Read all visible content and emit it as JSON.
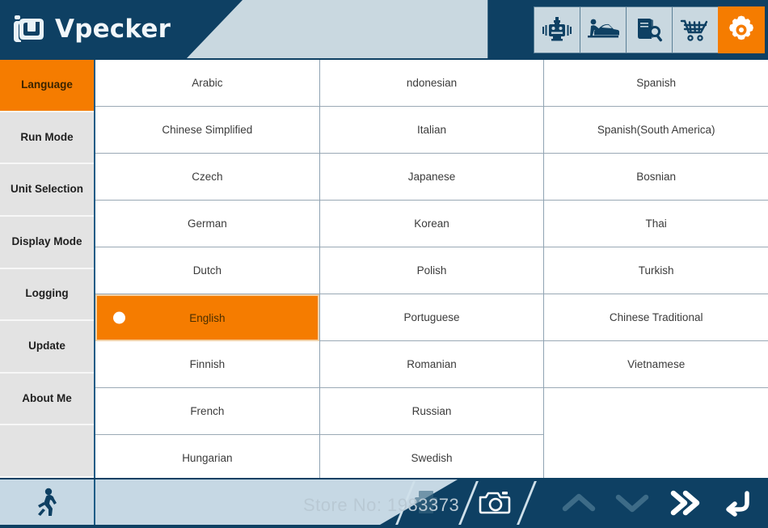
{
  "app": {
    "brand": "Vpecker",
    "logo_icon": "id-logo-icon",
    "accent_color": "#f57c00",
    "navy_color": "#0e4063",
    "panel_color": "#c9d8e0"
  },
  "header": {
    "icons": [
      {
        "name": "diagnostic-tool-icon",
        "label": "Diagnostic",
        "active": false
      },
      {
        "name": "car-repair-icon",
        "label": "Repair",
        "active": false
      },
      {
        "name": "manual-search-icon",
        "label": "Manual",
        "active": false
      },
      {
        "name": "shopping-cart-icon",
        "label": "Shop",
        "active": false
      },
      {
        "name": "settings-gear-icon",
        "label": "Settings",
        "active": true
      }
    ]
  },
  "sidebar": {
    "items": [
      {
        "label": "Language",
        "active": true
      },
      {
        "label": "Run Mode",
        "active": false
      },
      {
        "label": "Unit Selection",
        "active": false
      },
      {
        "label": "Display Mode",
        "active": false
      },
      {
        "label": "Logging",
        "active": false
      },
      {
        "label": "Update",
        "active": false
      },
      {
        "label": "About Me",
        "active": false
      },
      {
        "label": "",
        "active": false
      }
    ]
  },
  "languages": {
    "selected": "English",
    "columns": [
      {
        "items": [
          {
            "label": "Arabic",
            "selected": false
          },
          {
            "label": "Chinese Simplified",
            "selected": false
          },
          {
            "label": "Czech",
            "selected": false
          },
          {
            "label": "German",
            "selected": false
          },
          {
            "label": "Dutch",
            "selected": false
          },
          {
            "label": "English",
            "selected": true
          },
          {
            "label": "Finnish",
            "selected": false
          },
          {
            "label": "French",
            "selected": false
          },
          {
            "label": "Hungarian",
            "selected": false
          }
        ]
      },
      {
        "items": [
          {
            "label": "ndonesian",
            "selected": false
          },
          {
            "label": "Italian",
            "selected": false
          },
          {
            "label": "Japanese",
            "selected": false
          },
          {
            "label": "Korean",
            "selected": false
          },
          {
            "label": "Polish",
            "selected": false
          },
          {
            "label": "Portuguese",
            "selected": false
          },
          {
            "label": "Romanian",
            "selected": false
          },
          {
            "label": "Russian",
            "selected": false
          },
          {
            "label": "Swedish",
            "selected": false
          }
        ]
      },
      {
        "items": [
          {
            "label": "Spanish",
            "selected": false
          },
          {
            "label": "Spanish(South America)",
            "selected": false
          },
          {
            "label": "Bosnian",
            "selected": false
          },
          {
            "label": "Thai",
            "selected": false
          },
          {
            "label": "Turkish",
            "selected": false
          },
          {
            "label": "Chinese Traditional",
            "selected": false
          },
          {
            "label": "Vietnamese",
            "selected": false
          }
        ]
      }
    ]
  },
  "footer": {
    "run_icon": "running-person-icon",
    "print_icon": "printer-icon",
    "camera_icon": "camera-icon",
    "up_icon": "chevron-up-icon",
    "down_icon": "chevron-down-icon",
    "forward_icon": "double-chevron-right-icon",
    "back_icon": "back-arrow-icon"
  },
  "watermark": {
    "text": "Store No: 1983373"
  }
}
